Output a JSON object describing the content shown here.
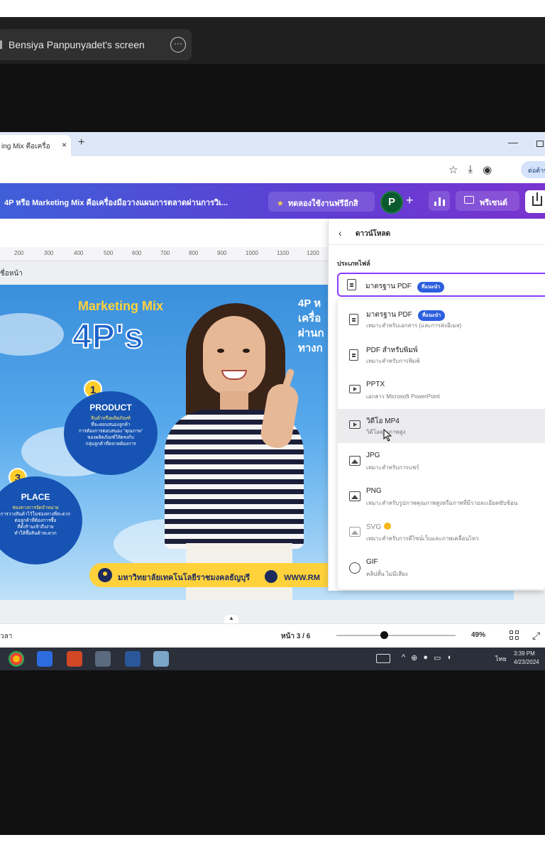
{
  "zoom": {
    "share_label": "Bensiya Panpunyadet's screen",
    "more_icon": "ellipsis-icon"
  },
  "browser": {
    "tab_title": "ing Mix คือเครื่อ",
    "tab_close": "×",
    "new_tab": "+",
    "profile_chip": "ต่อต้าน"
  },
  "canva": {
    "doc_title": "4P หรือ Marketing Mix คือเครื่องมือวางแผนการตลาดผ่านการวิเ...",
    "trial_label": "ทดลองใช้งานฟรีอีกสิ",
    "avatar_letter": "P",
    "present_label": "พรีเซนต์"
  },
  "ruler": [
    "200",
    "300",
    "400",
    "500",
    "600",
    "700",
    "800",
    "900",
    "1000",
    "1100",
    "1200"
  ],
  "page_label": "ชื่อหน้า",
  "poster": {
    "title": "Marketing Mix",
    "big": "4P's",
    "heading_line1": "4P ห",
    "heading_line2": "เครื่อ",
    "heading_line3": "ผ่านก",
    "heading_line4": "ทางก",
    "product": {
      "num": "1",
      "title": "PRODUCT",
      "line1": "สินค้าหรือผลิตภัณฑ์",
      "line2": "ที่จะตอบสนองลูกค้า",
      "line3": "การต้องการตอบสนอง \"คุณภาพ\"",
      "line4": "ของผลิตภัณฑ์ให้ตรงกับ",
      "line5": "กลุ่มลูกค้าที่ตลาดต้องการ"
    },
    "place": {
      "num": "3",
      "title": "PLACE",
      "line1": "ช่องทางการจัดจำหน่าย",
      "line2": "การวางสินค้าไว้ในช่องทางที่สะดวก",
      "line3": "ต่อลูกค้าที่ต้องการซื้อ",
      "line4": "ที่ตั้งร้านเข้าถึงง่าย",
      "line5": "ทำให้ซื้อสินค้าสะดวก"
    },
    "strip_text": "มหาวิทยาลัยเทคโนโลยีราชมงคลธัญบุรี",
    "strip_www": "WWW.RM"
  },
  "download": {
    "title": "ดาวน์โหลด",
    "file_type_label": "ประเภทไฟล์",
    "selected": "มาตรฐาน PDF",
    "recommended": "ที่แนะนำ",
    "options": [
      {
        "name": "มาตรฐาน PDF",
        "desc": "เหมาะสำหรับเอกสาร (และการส่งอีเมล)",
        "icon": "file-pdf-icon",
        "badge": "ที่แนะนำ"
      },
      {
        "name": "PDF สำหรับพิมพ์",
        "desc": "เหมาะสำหรับการพิมพ์",
        "icon": "file-print-icon"
      },
      {
        "name": "PPTX",
        "desc": "เอกสาร Microsoft PowerPoint",
        "icon": "presentation-icon"
      },
      {
        "name": "วิดีโอ MP4",
        "desc": "วิดีโอคุณภาพสูง",
        "icon": "video-icon"
      },
      {
        "name": "JPG",
        "desc": "เหมาะสำหรับการแชร์",
        "icon": "image-icon"
      },
      {
        "name": "PNG",
        "desc": "เหมาะสำหรับรูปภาพคุณภาพสูงหรือภาพที่มีรายละเอียดซับซ้อน",
        "icon": "image-icon"
      },
      {
        "name": "SVG",
        "desc": "เหมาะสำหรับการดีไซน์เว็บและภาพเคลื่อนไหว",
        "icon": "image-icon"
      },
      {
        "name": "GIF",
        "desc": "คลิปสั้น ไม่มีเสียง",
        "icon": "gif-icon"
      }
    ]
  },
  "footer": {
    "notes": "วลา",
    "page": "หน้า 3 / 6",
    "zoom": "49%",
    "zoom_level": 0.4
  },
  "taskbar": {
    "time": "3:39 PM",
    "date": "4/23/2024",
    "lang": "ไทย"
  }
}
